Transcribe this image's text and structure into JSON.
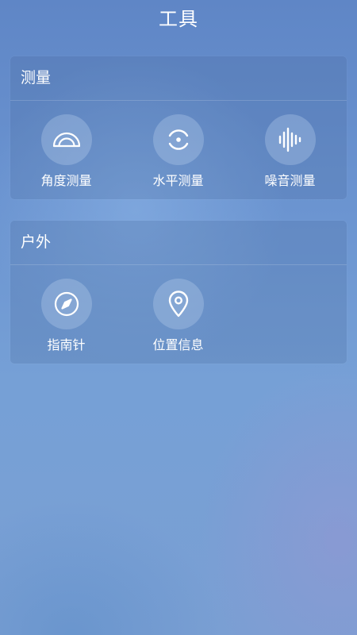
{
  "header": {
    "title": "工具"
  },
  "sections": [
    {
      "title": "测量",
      "tools": [
        {
          "label": "角度测量",
          "icon": "protractor-icon"
        },
        {
          "label": "水平测量",
          "icon": "level-icon"
        },
        {
          "label": "噪音测量",
          "icon": "sound-wave-icon"
        }
      ]
    },
    {
      "title": "户外",
      "tools": [
        {
          "label": "指南针",
          "icon": "compass-icon"
        },
        {
          "label": "位置信息",
          "icon": "location-pin-icon"
        }
      ]
    }
  ],
  "theme": {
    "background_top": "#5f86c6",
    "background_bottom": "#7a9fd3",
    "text": "#ffffff"
  }
}
